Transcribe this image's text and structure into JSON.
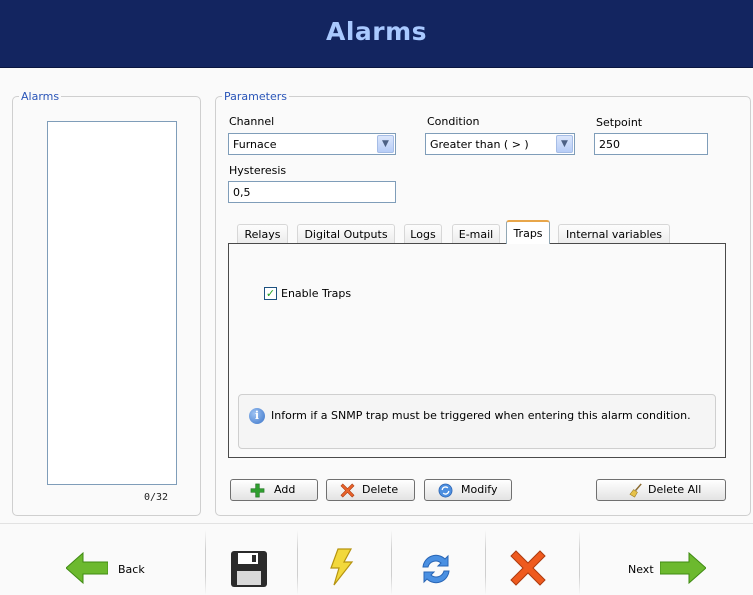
{
  "header": {
    "title": "Alarms"
  },
  "alarms_panel": {
    "legend": "Alarms",
    "count": "0/32"
  },
  "parameters": {
    "legend": "Parameters",
    "channel": {
      "label": "Channel",
      "value": "Furnace"
    },
    "condition": {
      "label": "Condition",
      "value": "Greater than ( > )"
    },
    "setpoint": {
      "label": "Setpoint",
      "value": "250"
    },
    "hysteresis": {
      "label": "Hysteresis",
      "value": "0,5"
    },
    "tabs": [
      "Relays",
      "Digital Outputs",
      "Logs",
      "E-mail",
      "Traps",
      "Internal variables"
    ],
    "active_tab": "Traps",
    "traps": {
      "enable_label": "Enable Traps",
      "enabled": true,
      "info": "Inform if a SNMP trap must be triggered when entering this alarm condition."
    }
  },
  "buttons": {
    "add": "Add",
    "delete": "Delete",
    "modify": "Modify",
    "delete_all": "Delete All"
  },
  "footer": {
    "back": "Back",
    "next": "Next",
    "icons": [
      "back-arrow-icon",
      "save-icon",
      "lightning-icon",
      "refresh-icon",
      "cancel-x-icon",
      "next-arrow-icon"
    ]
  },
  "colors": {
    "header_bg": "#132560",
    "header_text": "#a9c9ff",
    "legend_text": "#2a55b8",
    "active_tab_accent": "#e8a64a"
  }
}
